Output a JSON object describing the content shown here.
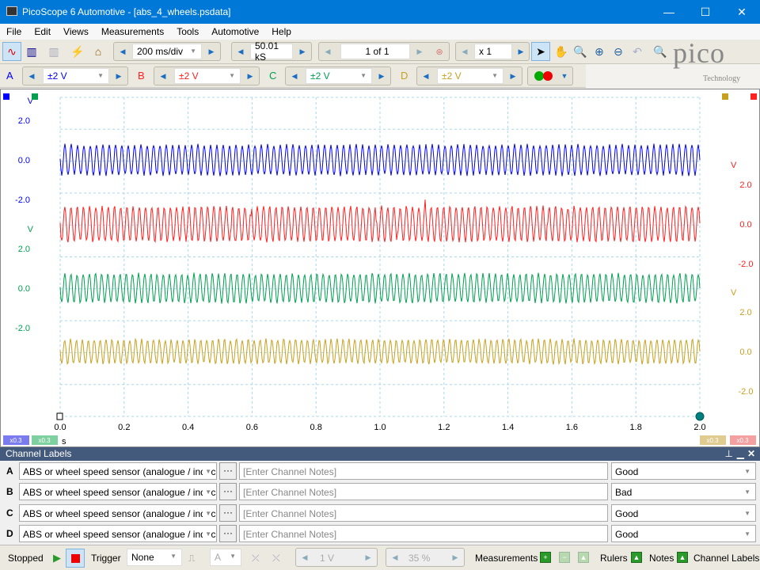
{
  "window": {
    "title": "PicoScope 6 Automotive - [abs_4_wheels.psdata]",
    "minimize": "—",
    "maximize": "☐",
    "close": "✕"
  },
  "menu": [
    "File",
    "Edit",
    "Views",
    "Measurements",
    "Tools",
    "Automotive",
    "Help"
  ],
  "toolbar": {
    "timebase": "200 ms/div",
    "samples": "50.01 kS",
    "buffer": "1 of 1",
    "zoom": "x 1",
    "logo": "pico",
    "logo_sub": "Technology"
  },
  "channels": [
    {
      "letter": "A",
      "range": "±2 V",
      "color": "#0000ff"
    },
    {
      "letter": "B",
      "range": "±2 V",
      "color": "#ff2020"
    },
    {
      "letter": "C",
      "range": "±2 V",
      "color": "#00a050"
    },
    {
      "letter": "D",
      "range": "±2 V",
      "color": "#c8a020"
    }
  ],
  "scope": {
    "x_ticks": [
      "0.0",
      "0.2",
      "0.4",
      "0.6",
      "0.8",
      "1.0",
      "1.2",
      "1.4",
      "1.6",
      "1.8",
      "2.0"
    ],
    "x_unit": "s",
    "axis_unit": "V",
    "y_ticks": [
      "2.0",
      "0.0",
      "-2.0"
    ],
    "zoom_badges": [
      "x0.3",
      "x0.3",
      "x0.3",
      "x0.3"
    ]
  },
  "channel_labels": {
    "title": "Channel Labels",
    "rows": [
      {
        "letter": "A",
        "sensor": "ABS or wheel speed sensor (analogue / induc",
        "notes_placeholder": "[Enter Channel Notes]",
        "status": "Good"
      },
      {
        "letter": "B",
        "sensor": "ABS or wheel speed sensor (analogue / induc",
        "notes_placeholder": "[Enter Channel Notes]",
        "status": "Bad"
      },
      {
        "letter": "C",
        "sensor": "ABS or wheel speed sensor (analogue / induc",
        "notes_placeholder": "[Enter Channel Notes]",
        "status": "Good"
      },
      {
        "letter": "D",
        "sensor": "ABS or wheel speed sensor (analogue / induc",
        "notes_placeholder": "[Enter Channel Notes]",
        "status": "Good"
      }
    ]
  },
  "statusbar": {
    "state": "Stopped",
    "trigger_label": "Trigger",
    "trigger_mode": "None",
    "trigger_source": "A",
    "level": "1 V",
    "pretrigger": "35 %",
    "measurements": "Measurements",
    "rulers": "Rulers",
    "notes": "Notes",
    "channel_labels": "Channel Labels"
  }
}
